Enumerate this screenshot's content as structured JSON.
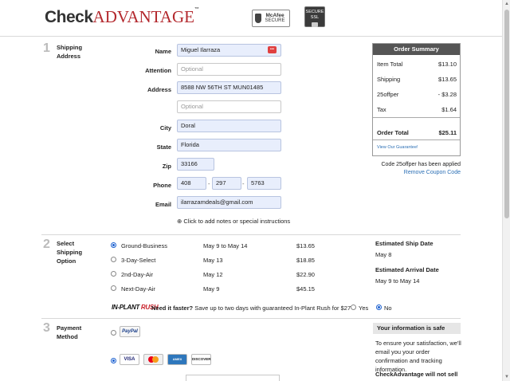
{
  "header": {
    "logo_part1": "Check",
    "logo_part2": "ADVANTAGE",
    "logo_tm": "™",
    "badge_mcafee_line1": "McAfee",
    "badge_mcafee_line2": "SECURE",
    "badge_secure_line1": "SECURE",
    "badge_secure_line2": "SSL"
  },
  "shipping": {
    "step_number": "1",
    "step_label_1": "Shipping",
    "step_label_2": "Address",
    "labels": {
      "name": "Name",
      "attention": "Attention",
      "address": "Address",
      "city": "City",
      "state": "State",
      "zip": "Zip",
      "phone": "Phone",
      "email": "Email"
    },
    "values": {
      "name": "Miguel Ilarraza",
      "attention_placeholder": "Optional",
      "address": "8588 NW 56TH ST MUN01485",
      "address2_placeholder": "Optional",
      "city": "Doral",
      "state": "Florida",
      "zip": "33166",
      "phone_1": "408",
      "phone_2": "297",
      "phone_3": "5763",
      "email": "ilarrazamdeals@gmail.com"
    },
    "autofill_icon_text": "•••",
    "phone_separator": "-",
    "add_notes": "⊕ Click to add notes or special instructions"
  },
  "order_summary": {
    "title": "Order Summary",
    "rows": [
      {
        "label": "Item Total",
        "value": "$13.10"
      },
      {
        "label": "Shipping",
        "value": "$13.65"
      },
      {
        "label": "25offper",
        "value": "- $3.28"
      },
      {
        "label": "Tax",
        "value": "$1.64"
      }
    ],
    "total_label": "Order Total",
    "total_value": "$25.11",
    "guarantee_link": "View Our Guarantee!",
    "coupon_applied": "Code 25offper has been applied",
    "remove_coupon": "Remove Coupon Code"
  },
  "shipping_option": {
    "step_number": "2",
    "step_label_1": "Select",
    "step_label_2": "Shipping",
    "step_label_3": "Option",
    "options": [
      {
        "name": "Ground-Business",
        "dates": "May 9 to May 14",
        "price": "$13.65",
        "selected": true
      },
      {
        "name": "3-Day-Select",
        "dates": "May 13",
        "price": "$18.85",
        "selected": false
      },
      {
        "name": "2nd-Day-Air",
        "dates": "May 12",
        "price": "$22.90",
        "selected": false
      },
      {
        "name": "Next-Day-Air",
        "dates": "May 9",
        "price": "$45.15",
        "selected": false
      }
    ],
    "est_ship_label": "Estimated Ship Date",
    "est_ship_value": "May 8",
    "est_arrival_label": "Estimated Arrival Date",
    "est_arrival_value": "May 9 to May 14",
    "rush_logo_1": "IN-PLANT ",
    "rush_logo_2": "RUSH",
    "rush_question": "Need it faster?",
    "rush_text": " Save up to two days with guaranteed In-Plant Rush for $27",
    "rush_yes": "Yes",
    "rush_no": "No"
  },
  "payment": {
    "step_number": "3",
    "step_label_1": "Payment",
    "step_label_2": "Method",
    "paypal": "PayPal",
    "cards": [
      "VISA",
      "MC",
      "AMEX",
      "DISCOVER"
    ],
    "safe_title": "Your information is safe",
    "safe_text": "To ensure your satisfaction, we'll email you your order confirmation and tracking information.",
    "safe_bold": "CheckAdvantage will not sell"
  },
  "colors": {
    "accent_red": "#b3282d",
    "link_blue": "#2b6fb5",
    "autofill_blue": "#e8eefc",
    "summary_header": "#555555"
  }
}
